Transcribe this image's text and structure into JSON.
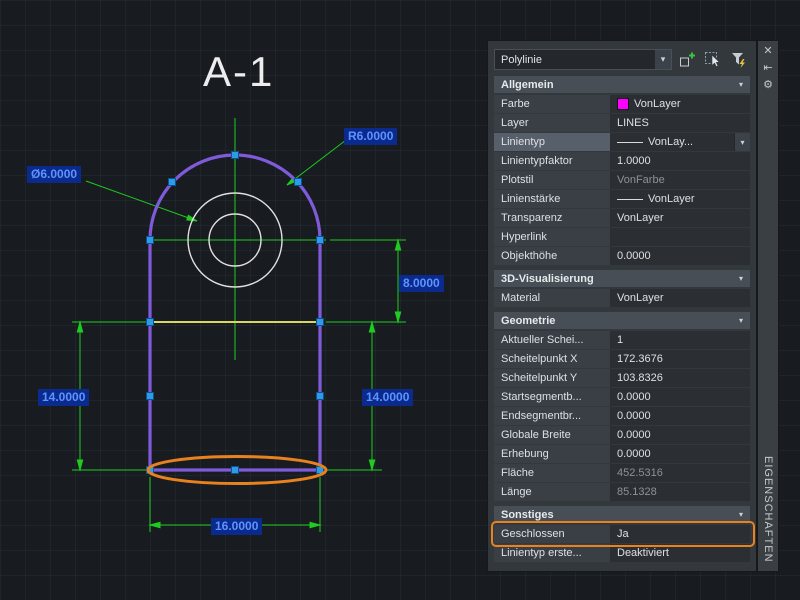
{
  "drawing": {
    "title": "A-1",
    "labels": {
      "radius": "R6.0000",
      "diameter": "Ø6.0000",
      "height_upper": "8.0000",
      "height_left": "14.0000",
      "height_right": "14.0000",
      "width_bottom": "16.0000"
    },
    "colors": {
      "dimension_green": "#1ecb1e",
      "polyline_purple": "#7f5bd9",
      "grip_blue": "#2e9be5",
      "highlight_orange": "#e8821e",
      "dim_label_bg": "#0b2a8e",
      "dim_label_text": "#5e93ff",
      "yellow_line": "#d8d85e",
      "layer_magenta": "#ff00ff"
    }
  },
  "palette": {
    "selector": {
      "value": "Polylinie"
    },
    "vertical_title": "EIGENSCHAFTEN",
    "icons": {
      "close": "✕",
      "autohide": "⇤",
      "settings": "⚙",
      "dropdown": "▾",
      "section_collapse": "▾"
    },
    "toolbar_icons": [
      {
        "name": "pickadd-toggle"
      },
      {
        "name": "select-objects"
      },
      {
        "name": "quick-select"
      }
    ],
    "sections": [
      {
        "title": "Allgemein",
        "rows": [
          {
            "label": "Farbe",
            "value": "VonLayer"
          },
          {
            "label": "Layer",
            "value": "LINES"
          },
          {
            "label": "Linientyp",
            "value": "VonLay..."
          },
          {
            "label": "Linientypfaktor",
            "value": "1.0000"
          },
          {
            "label": "Plotstil",
            "value": "VonFarbe"
          },
          {
            "label": "Linienstärke",
            "value": "VonLayer"
          },
          {
            "label": "Transparenz",
            "value": "VonLayer"
          },
          {
            "label": "Hyperlink",
            "value": ""
          },
          {
            "label": "Objekthöhe",
            "value": "0.0000"
          }
        ]
      },
      {
        "title": "3D-Visualisierung",
        "rows": [
          {
            "label": "Material",
            "value": "VonLayer"
          }
        ]
      },
      {
        "title": "Geometrie",
        "rows": [
          {
            "label": "Aktueller Schei...",
            "value": "1"
          },
          {
            "label": "Scheitelpunkt X",
            "value": "172.3676"
          },
          {
            "label": "Scheitelpunkt Y",
            "value": "103.8326"
          },
          {
            "label": "Startsegmentb...",
            "value": "0.0000"
          },
          {
            "label": "Endsegmentbr...",
            "value": "0.0000"
          },
          {
            "label": "Globale Breite",
            "value": "0.0000"
          },
          {
            "label": "Erhebung",
            "value": "0.0000"
          },
          {
            "label": "Fläche",
            "value": "452.5316"
          },
          {
            "label": "Länge",
            "value": "85.1328"
          }
        ]
      },
      {
        "title": "Sonstiges",
        "rows": [
          {
            "label": "Geschlossen",
            "value": "Ja"
          },
          {
            "label": "Linientyp erste...",
            "value": "Deaktiviert"
          }
        ]
      }
    ]
  }
}
